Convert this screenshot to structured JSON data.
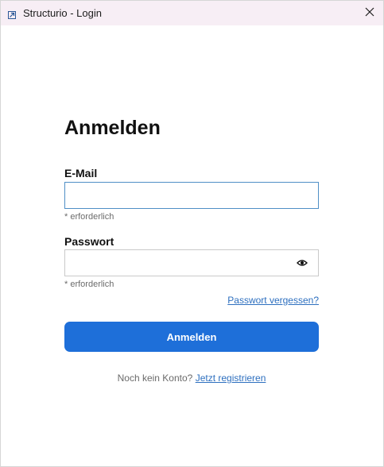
{
  "window": {
    "title": "Structurio - Login",
    "close_symbol": "×"
  },
  "login": {
    "heading": "Anmelden",
    "email_label": "E-Mail",
    "email_value": "",
    "email_hint": "* erforderlich",
    "password_label": "Passwort",
    "password_value": "",
    "password_hint": "* erforderlich",
    "forgot_link": "Passwort vergessen?",
    "submit_label": "Anmelden",
    "register_prompt": "Noch kein Konto?",
    "register_link": "Jetzt registrieren"
  },
  "colors": {
    "titlebar_bg": "#f7eef5",
    "accent": "#1e6fd9",
    "link": "#2d6fbf"
  },
  "icons": {
    "app": "app-logo-icon",
    "close": "close-icon",
    "password_toggle": "eye-icon"
  }
}
